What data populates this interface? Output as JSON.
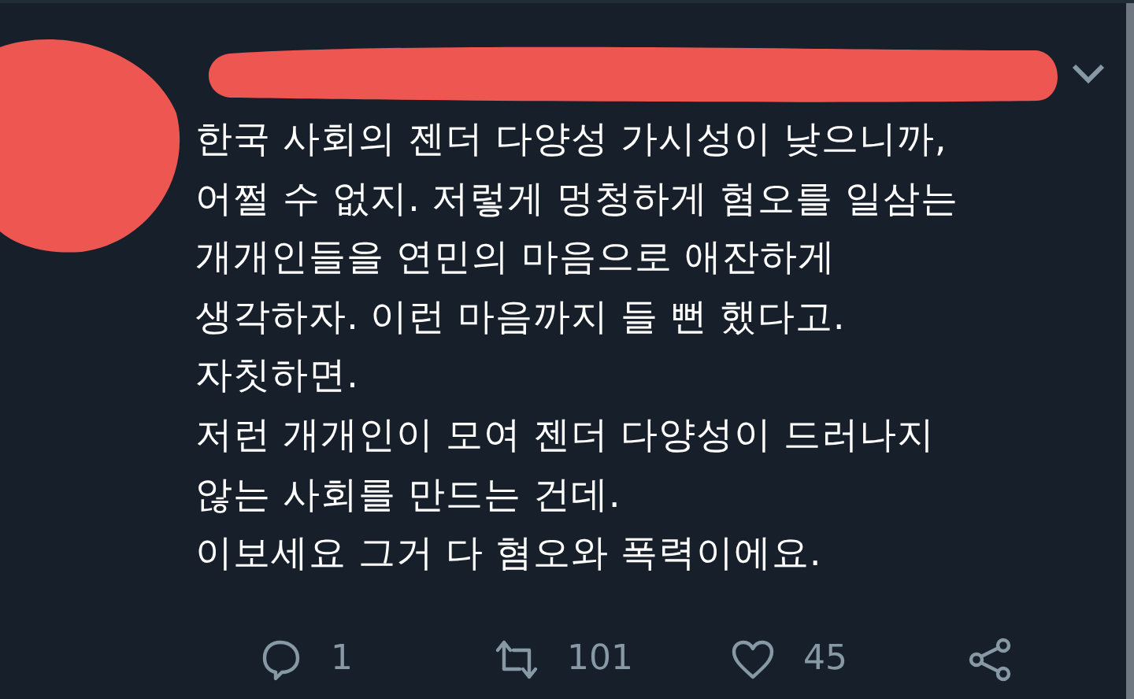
{
  "tweet": {
    "lines": [
      "한국 사회의 젠더 다양성 가시성이 낮으니까,",
      "어쩔 수 없지. 저렇게 멍청하게 혐오를 일삼는",
      "개개인들을 연민의 마음으로 애잔하게",
      "생각하자. 이런 마음까지 들 뻔 했다고.",
      "자칫하면.",
      "저런 개개인이 모여 젠더 다양성이 드러나지",
      "않는 사회를 만드는 건데.",
      "이보세요 그거 다 혐오와 폭력이에요."
    ],
    "actions": [
      {
        "kind": "reply",
        "count": "1"
      },
      {
        "kind": "retweet",
        "count": "101"
      },
      {
        "kind": "like",
        "count": "45"
      },
      {
        "kind": "share"
      }
    ]
  }
}
